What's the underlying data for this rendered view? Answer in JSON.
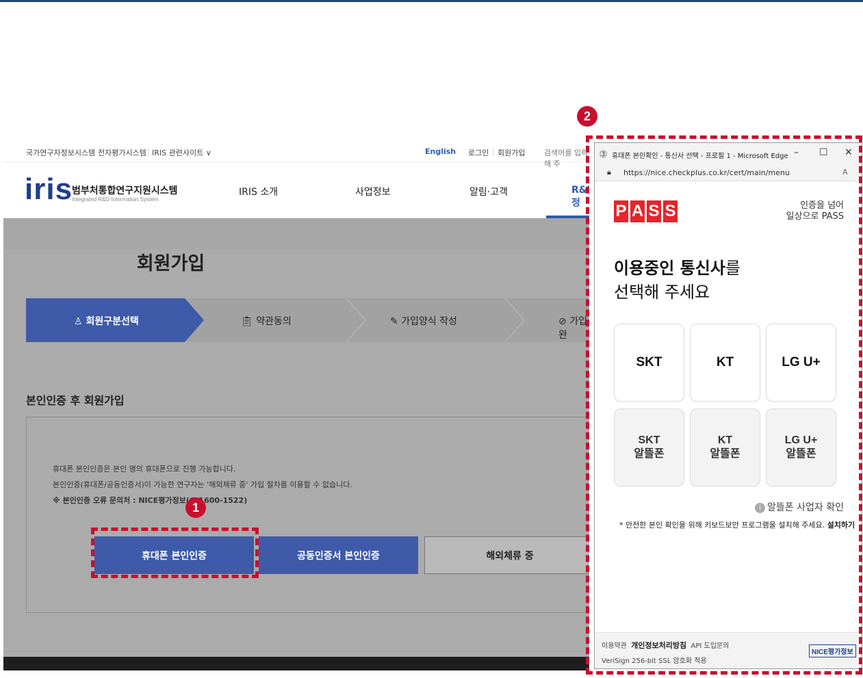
{
  "badges": {
    "one": "1",
    "two": "2"
  },
  "util": {
    "left1": "국가연구자정보시스템",
    "left2": "전자평가시스템",
    "left3": "IRIS 관련사이트 ∨",
    "english": "English",
    "login": "로그인",
    "join": "회원가입",
    "search_placeholder": "검색어를 입력해 주"
  },
  "logo": {
    "mark": "iris",
    "title": "범부처통합연구지원시스템",
    "subtitle": "Integrated R&D Information System"
  },
  "menu": [
    "IRIS 소개",
    "사업정보",
    "알림·고객",
    "R&D 정"
  ],
  "page_title": "회원가입",
  "steps": [
    "회원구분선택",
    "약관동의",
    "가입양식 작성",
    "가입완"
  ],
  "section_title": "본인인증 후 회원가입",
  "notices": [
    "휴대폰 본인인증은 본인 명의 휴대폰으로 진행 가능합니다.",
    "본인인증(휴대폰/공동인증서)이 가능한 연구자는 '해외체류 중' 가입 절차를 이용할 수 없습니다.",
    "※ 본인인증 오류 문의처 : NICE평가정보(☎1600-1522)"
  ],
  "buttons": {
    "phone": "휴대폰 본인인증",
    "cert": "공동인증서 본인인증",
    "overseas": "해외체류 중"
  },
  "popup": {
    "window_title": "휴대폰 본인확인 - 통신사 선택 - 프로필 1 - Microsoft Edge",
    "url": "https://nice.checkplus.co.kr/cert/main/menu",
    "pass_letters": [
      "P",
      "A",
      "S",
      "S"
    ],
    "slogan_line1": "인증을 넘어",
    "slogan_line2": "일상으로 PASS",
    "headline_bold": "이용중인 통신사",
    "headline_rest": "를",
    "headline2": "선택해 주세요",
    "carriers": [
      "SKT",
      "KT",
      "LG U+"
    ],
    "mvno": [
      {
        "name": "SKT",
        "sub": "알뜰폰"
      },
      {
        "name": "KT",
        "sub": "알뜰폰"
      },
      {
        "name": "LG U+",
        "sub": "알뜰폰"
      }
    ],
    "mvno_check": "알뜰폰 사업자 확인",
    "kbd_note": "* 안전한 본인 확인을 위해 키보드보안 프로그램을 설치해 주세요.",
    "install": "설치하기",
    "footer_terms": "이용약관",
    "footer_privacy": "개인정보처리방침",
    "footer_api": "API 도입문의",
    "footer_ssl": "VeriSign 256-bit SSL 암호화 적용",
    "nice_logo": "NICE평가정보"
  },
  "colors": {
    "accent": "#3e5aa8",
    "highlight": "#c8102e",
    "pass_red": "#e8232a"
  }
}
